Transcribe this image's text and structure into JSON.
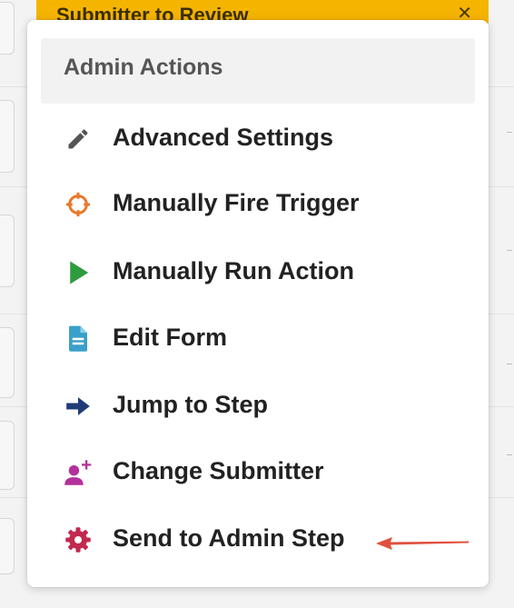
{
  "top_bar": {
    "label": "Submitter to Review",
    "chevron_icon": "chevron-down-icon",
    "color": "#f5b400"
  },
  "menu": {
    "header": "Admin Actions",
    "items": [
      {
        "label": "Advanced Settings",
        "icon": "pencil-icon",
        "color": "#555555"
      },
      {
        "label": "Manually Fire Trigger",
        "icon": "crosshair-icon",
        "color": "#e8782a"
      },
      {
        "label": "Manually Run Action",
        "icon": "play-icon",
        "color": "#2e9b3e"
      },
      {
        "label": "Edit Form",
        "icon": "document-icon",
        "color": "#3aa0c9"
      },
      {
        "label": "Jump to Step",
        "icon": "arrow-right-icon",
        "color": "#1f3c78"
      },
      {
        "label": "Change Submitter",
        "icon": "user-plus-icon",
        "color": "#b2319a"
      },
      {
        "label": "Send to Admin Step",
        "icon": "gear-icon",
        "color": "#c2294f"
      }
    ]
  },
  "annotation": {
    "icon": "pointer-arrow-icon",
    "color": "#e1503c"
  }
}
